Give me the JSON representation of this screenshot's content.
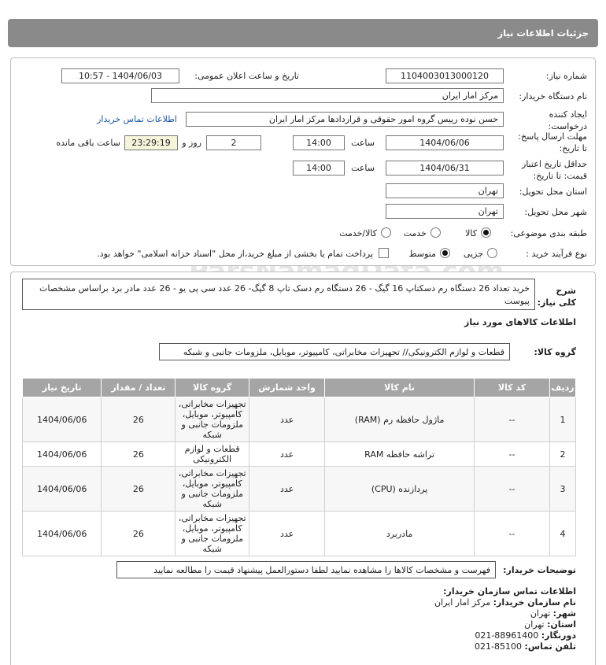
{
  "header": {
    "title": "جزئیات اطلاعات نیاز"
  },
  "form": {
    "need_number_label": "شماره نیاز:",
    "need_number": "1104003013000120",
    "announce_label": "تاریخ و ساعت اعلان عمومی:",
    "announce_value": "1404/06/03 - 10:57",
    "buyer_org_label": "نام دستگاه خریدار:",
    "buyer_org": "مرکز امار ایران",
    "creator_label": "ایجاد کننده درخواست:",
    "creator": "حسن نوده رییس گروه امور حقوقی و قراردادها مرکز امار ایران",
    "buyer_contact_link": "اطلاعات تماس خریدار",
    "reply_deadline_label": "مهلت ارسال پاسخ: تا تاریخ:",
    "reply_date": "1404/06/06",
    "time_label": "ساعت",
    "reply_time": "14:00",
    "days_value": "2",
    "days_label": "روز و",
    "remaining_time": "23:29:19",
    "remaining_label": "ساعت باقی مانده",
    "validity_label": "حداقل تاریخ اعتبار قیمت: تا تاریخ:",
    "validity_date": "1404/06/31",
    "validity_time": "14:00",
    "province_label": "استان محل تحویل:",
    "province": "تهران",
    "city_label": "شهر محل تحویل:",
    "city": "تهران",
    "category_label": "طبقه بندی موضوعی:",
    "category_options": [
      "کالا",
      "خدمت",
      "کالا/خدمت"
    ],
    "process_label": "نوع فرآیند خرید :",
    "process_options": [
      "جزیی",
      "متوسط"
    ],
    "payment_note": "پرداخت تمام یا بخشی از مبلغ خرید،از محل \"اسناد خزانه اسلامی\" خواهد بود."
  },
  "summary": {
    "label": "شرح کلی نیاز:",
    "text": "خرید تعداد 26 دستگاه رم دسکتاپ 16 گیگ - 26 دستگاه رم دسک تاپ 8 گیگ- 26 عدد سی پی یو - 26 عدد مادر برد براساس مشخصات پیوست",
    "goods_info_title": "اطلاعات کالاهای مورد نیاز",
    "goods_group_label": "گروه کالا:",
    "goods_group": "قطعات و لوازم الکترونیکی// تجهیزات مخابراتی، کامپیوتر، موبایل، ملزومات جانبی و شبکه"
  },
  "table": {
    "headers": [
      "ردیف",
      "کد کالا",
      "نام کالا",
      "واحد شمارش",
      "گروه کالا",
      "تعداد / مقدار",
      "تاریخ نیاز"
    ],
    "rows": [
      [
        "1",
        "--",
        "ماژول حافظه رم (RAM)",
        "عدد",
        "تجهیزات مخابراتی، کامپیوتر، موبایل، ملزومات جانبی و شبکه",
        "26",
        "1404/06/06"
      ],
      [
        "2",
        "--",
        "تراشه حافظه RAM",
        "عدد",
        "قطعات و لوازم الکترونیکی",
        "26",
        "1404/06/06"
      ],
      [
        "3",
        "--",
        "پردازنده (CPU)",
        "عدد",
        "تجهیزات مخابراتی، کامپیوتر، موبایل، ملزومات جانبی و شبکه",
        "26",
        "1404/06/06"
      ],
      [
        "4",
        "--",
        "مادربرد",
        "عدد",
        "تجهیزات مخابراتی، کامپیوتر، موبایل، ملزومات جانبی و شبکه",
        "26",
        "1404/06/06"
      ]
    ]
  },
  "buyer_notes": {
    "label": "توضیحات خریدار:",
    "text": "فهرست و مشخصات کالاها را مشاهده نمایید لطفا دستورالعمل پیشنهاد قیمت را مطالعه نمایید"
  },
  "contact": {
    "title": "اطلاعات تماس سازمان خریدار:",
    "org_label": "نام سازمان خریدار:",
    "org": "مرکز امار ایران",
    "city_label": "شهر:",
    "city": "تهران",
    "province_label": "استان:",
    "province": "تهران",
    "fax_label": "دورنگار:",
    "fax": "021-88961400",
    "phone_label": "تلفن تماس:",
    "phone": "021-85100"
  },
  "watermark": {
    "digits": "019181",
    "site": "ParsNamadData.com",
    "tagline": "مرکز فراوری اطلاعات پارس نماد داده",
    "tagline2": "پایگاه جامع اطلاع رسانی مناقصه و مزایده",
    "phone": "۰۲۱-۸۸۳۴۹۶۷۰"
  }
}
